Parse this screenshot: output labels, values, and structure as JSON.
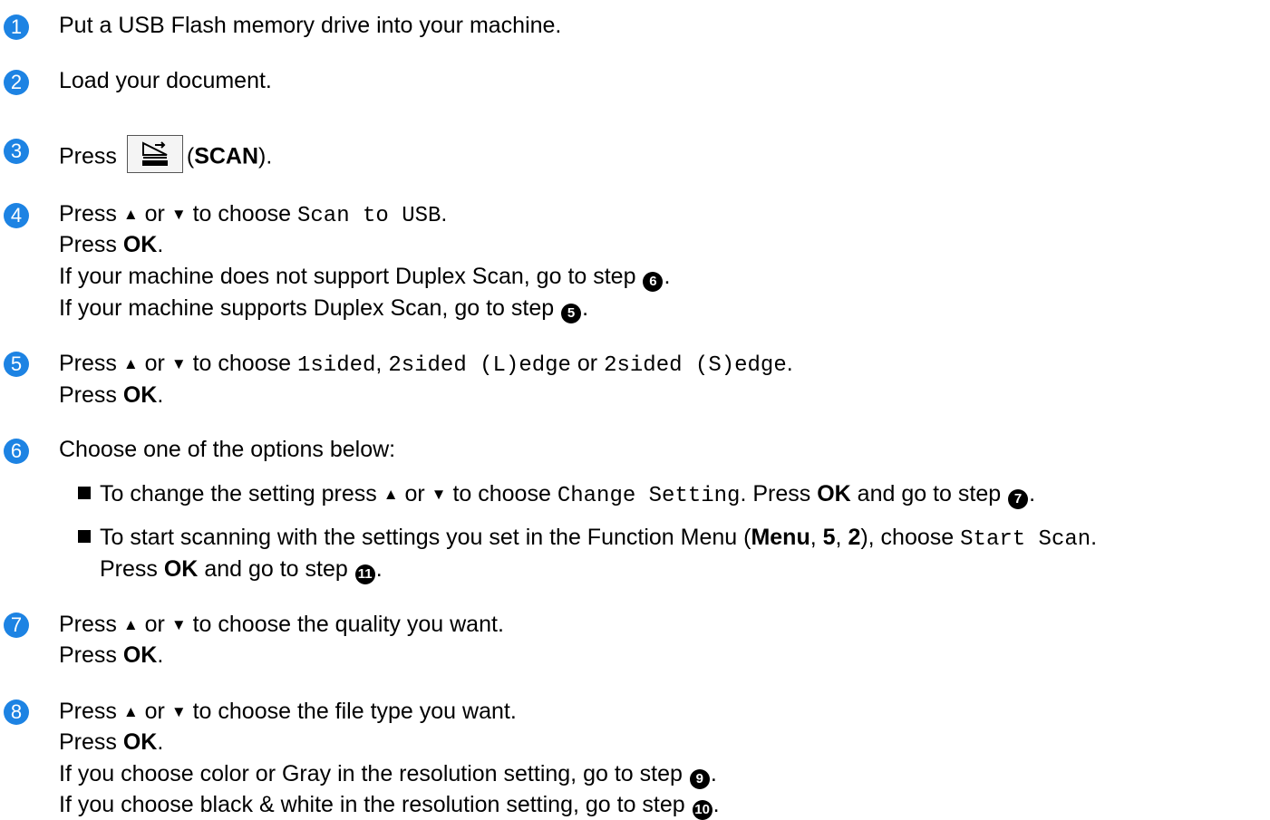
{
  "steps": [
    {
      "num": "1",
      "text": "Put a USB Flash memory drive into your machine."
    },
    {
      "num": "2",
      "text": "Load your document."
    },
    {
      "num": "3",
      "press": "Press",
      "paren_open": "(",
      "scan": "SCAN",
      "paren_close": ")."
    },
    {
      "num": "4",
      "press": "Press",
      "or": "or",
      "to_choose": "to choose",
      "option": "Scan to USB",
      "period": ".",
      "press_ok_a": "Press",
      "ok": "OK",
      "line3": "If your machine does not support Duplex Scan, go to step",
      "line3_ref": "6",
      "line4": "If your machine supports Duplex Scan, go to step",
      "line4_ref": "5"
    },
    {
      "num": "5",
      "press": "Press",
      "or": "or",
      "to_choose": "to choose",
      "opt1": "1sided",
      "comma": ",",
      "opt2": "2sided (L)edge",
      "or2": "or",
      "opt3": "2sided (S)edge",
      "period": ".",
      "press_ok_a": "Press",
      "ok": "OK"
    },
    {
      "num": "6",
      "text": "Choose one of the options below:",
      "b1_a": "To change the setting press",
      "b1_or": "or",
      "b1_to_choose": "to choose",
      "b1_option": "Change Setting",
      "b1_press": ". Press",
      "b1_ok": "OK",
      "b1_tail": "and go to step",
      "b1_ref": "7",
      "b2_a": "To start scanning with the settings you set in the Function Menu (",
      "b2_menu": "Menu",
      "b2_sep1": ",",
      "b2_5": "5",
      "b2_sep2": ",",
      "b2_2": "2",
      "b2_close": "), choose",
      "b2_option": "Start Scan",
      "b2_press": "Press",
      "b2_ok": "OK",
      "b2_tail": "and go to step",
      "b2_ref": "11"
    },
    {
      "num": "7",
      "press": "Press",
      "or": "or",
      "text": "to choose the quality you want.",
      "press_ok_a": "Press",
      "ok": "OK"
    },
    {
      "num": "8",
      "press": "Press",
      "or": "or",
      "text": "to choose the file type you want.",
      "press_ok_a": "Press",
      "ok": "OK",
      "line3": "If you choose color or Gray in the resolution setting, go to step",
      "line3_ref": "9",
      "line4": "If you choose black & white in the resolution setting, go to step",
      "line4_ref": "10"
    }
  ],
  "symbols": {
    "up": "▲",
    "down": "▼",
    "period": "."
  },
  "colors": {
    "step_circle": "#1d83e3"
  }
}
